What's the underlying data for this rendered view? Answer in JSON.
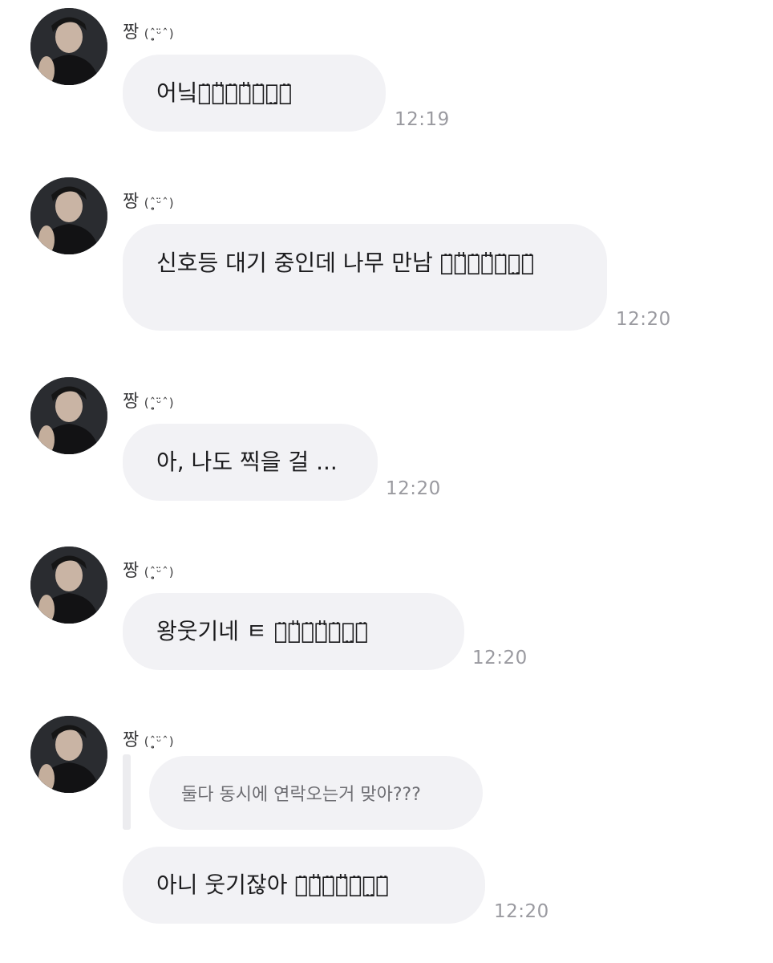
{
  "messages": [
    {
      "sender": "짱",
      "emote": "(ˆ̥̥̥̥̥̥ᵕ̈ˆ)",
      "text": "어닠ㅋ̈ㅋ̎ㅋ̈ㅋ̎ㅋ̈ㅋ̤ㅋ̈",
      "time": "12:19"
    },
    {
      "sender": "짱",
      "emote": "(ˆ̥̥̥̥̥̥ᵕ̈ˆ)",
      "text": "신호등 대기 중인데 나무 만남 ㅋ̈ㅋ̎ㅋ̈ㅋ̎ㅋ̈ㅋ̤ㅋ̈",
      "time": "12:20"
    },
    {
      "sender": "짱",
      "emote": "(ˆ̥̥̥̥̥̥ᵕ̈ˆ)",
      "text": "아, 나도 찍을 걸 ...",
      "time": "12:20"
    },
    {
      "sender": "짱",
      "emote": "(ˆ̥̥̥̥̥̥ᵕ̈ˆ)",
      "text": "왕웃기네 ㅌ ㅋ̈ㅋ̎ㅋ̈ㅋ̎ㅋ̈ㅋ̤ㅋ̈",
      "time": "12:20"
    },
    {
      "sender": "짱",
      "emote": "(ˆ̥̥̥̥̥̥ᵕ̈ˆ)",
      "quote": "둘다 동시에 연락오는거 맞아???",
      "text": "아니 웃기잖아 ㅋ̈ㅋ̎ㅋ̈ㅋ̎ㅋ̈ㅋ̤ㅋ̈",
      "time": "12:20"
    }
  ]
}
